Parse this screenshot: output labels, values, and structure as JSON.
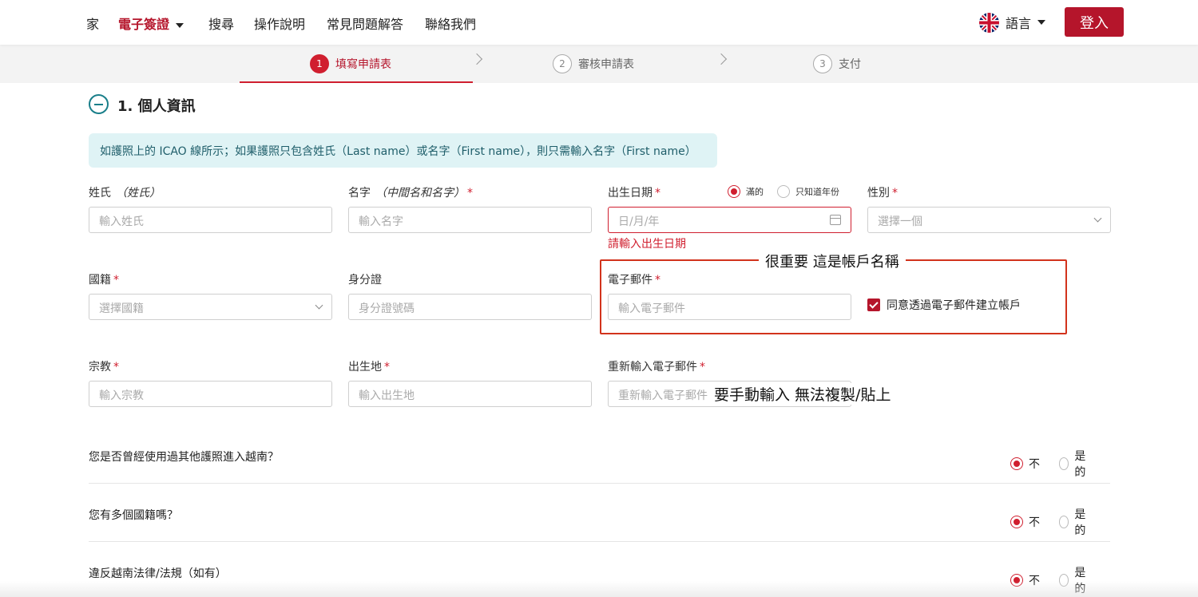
{
  "nav": {
    "items": [
      "家",
      "電子簽證",
      "搜尋",
      "操作說明",
      "常見問題解答",
      "聯絡我們"
    ],
    "language_label": "語言",
    "login_label": "登入"
  },
  "stepper": {
    "steps": [
      {
        "num": "1",
        "label": "填寫申請表"
      },
      {
        "num": "2",
        "label": "審核申請表"
      },
      {
        "num": "3",
        "label": "支付"
      }
    ]
  },
  "section": {
    "title": "1. 個人資訊",
    "notice": "如護照上的 ICAO 線所示；如果護照只包含姓氏（Last name）或名字（First name），則只需輸入名字（First name）"
  },
  "fields": {
    "surname": {
      "label": "姓氏",
      "hint": "（姓氏）",
      "placeholder": "輸入姓氏"
    },
    "given": {
      "label": "名字",
      "hint": "（中間名和名字）",
      "required": "*",
      "placeholder": "輸入名字"
    },
    "dob": {
      "label": "出生日期",
      "required": "*",
      "placeholder": "日/月/年",
      "error": "請輸入出生日期",
      "opt_full": "滿的",
      "opt_year": "只知道年份"
    },
    "gender": {
      "label": "性別",
      "required": "*",
      "placeholder": "選擇一個"
    },
    "nationality": {
      "label": "國籍",
      "required": "*",
      "placeholder": "選擇國籍"
    },
    "id_card": {
      "label": "身分證",
      "placeholder": "身分證號碼"
    },
    "email": {
      "label": "電子郵件",
      "required": "*",
      "placeholder": "輸入電子郵件"
    },
    "consent": {
      "label": "同意透過電子郵件建立帳戶",
      "checked": true
    },
    "religion": {
      "label": "宗教",
      "required": "*",
      "placeholder": "輸入宗教"
    },
    "birthplace": {
      "label": "出生地",
      "required": "*",
      "placeholder": "輸入出生地"
    },
    "email_confirm": {
      "label": "重新輸入電子郵件",
      "required": "*",
      "placeholder": "重新輸入電子郵件"
    }
  },
  "annotations": {
    "box_title": "很重要 這是帳戶名稱",
    "note": "要手動輸入 無法複製/貼上"
  },
  "questions": [
    {
      "text": "您是否曾經使用過其他護照進入越南？",
      "no": "不",
      "yes": "是的",
      "selected": "no"
    },
    {
      "text": "您有多個國籍嗎？",
      "no": "不",
      "yes": "是的",
      "selected": "no"
    },
    {
      "text": "違反越南法律/法規（如有）",
      "no": "不",
      "yes": "是的",
      "selected": "no"
    }
  ],
  "colors": {
    "brand": "#b5152b",
    "error": "#d01f2f",
    "teal": "#1a7f8a"
  }
}
